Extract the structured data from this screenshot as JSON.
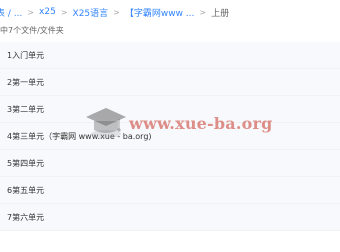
{
  "breadcrumb": {
    "items": [
      {
        "label": "x25"
      },
      {
        "label": "X25语言"
      },
      {
        "label": "【字霸网www ..."
      },
      {
        "label": "上册"
      }
    ],
    "leading_fragment": "表 / ...",
    "separator": ">"
  },
  "summary": "中7个文件/文件夹",
  "files": [
    {
      "name": "1入门单元"
    },
    {
      "name": "2第一单元"
    },
    {
      "name": "3第二单元"
    },
    {
      "name": "4第三单元（字霸网 www.xue - ba.org)"
    },
    {
      "name": "5第四单元"
    },
    {
      "name": "6第五单元"
    },
    {
      "name": "7第六单元"
    }
  ],
  "watermark": {
    "text": "www.xue-ba.org",
    "icon": "graduation-cap-icon"
  },
  "colors": {
    "link": "#3385ff",
    "row_background": "#f7f9fc",
    "watermark": "#c83728"
  }
}
